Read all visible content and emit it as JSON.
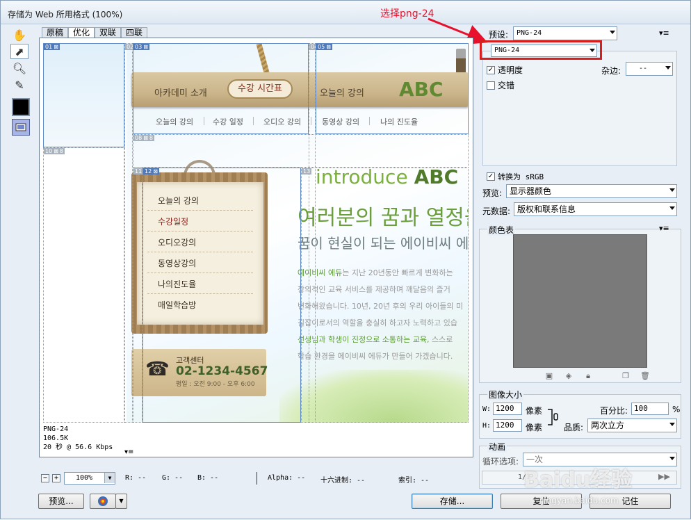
{
  "window": {
    "title": "存储为 Web 所用格式 (100%)"
  },
  "annotation": {
    "text": "选择png-24",
    "color": "#e8112d"
  },
  "tabs": [
    "原稿",
    "优化",
    "双联",
    "四联"
  ],
  "canvas": {
    "slices": [
      "01",
      "02",
      "03",
      "04",
      "05",
      "08",
      "10",
      "11",
      "12",
      "13"
    ],
    "nav": [
      "아카데미 소개",
      "수강 시간표",
      "오늘의 강의"
    ],
    "logo": "ABC",
    "subnav": [
      "오늘의 강의",
      "수강 일정",
      "오디오 강의",
      "동영상 강의",
      "나의 진도율"
    ],
    "menu": [
      "오늘의 강의",
      "수강일정",
      "오디오강의",
      "동영상강의",
      "나의진도율",
      "매일학습방"
    ],
    "phone": {
      "label": "고객센터",
      "number": "02-1234-4567",
      "hours": "평일 : 오전 9:00 - 오후 6:00"
    },
    "introduce": {
      "prefix": "introduce ",
      "brand": "ABC"
    },
    "heading1": "여러분의 꿈과 열정을",
    "heading2": "꿈이 현실이 되는 에이비씨 에",
    "body": [
      {
        "accent": "에이비씨 에듀",
        "text": "는 지난 20년동안 빠르게 변화하는"
      },
      {
        "accent": "",
        "text": "창의적인 교육 서비스를 제공하며 깨달음의 즐거"
      },
      {
        "accent": "",
        "text": "변화해왔습니다. 10년, 20년 후의 우리 아이들의 미"
      },
      {
        "accent": "",
        "text": "길잡이로서의 역할을 충실히 하고자 노력하고 있습"
      },
      {
        "accent": "선생님과 학생이 진정으로 소통하는 교육,",
        "text": " 스스로"
      },
      {
        "accent": "",
        "text": "학습 환경을 에이비씨 에듀가 만들어 가겠습니다."
      }
    ]
  },
  "info": {
    "format": "PNG-24",
    "size": "106.5K",
    "speed": "20 秒 @ 56.6 Kbps"
  },
  "status": {
    "zoom": "100%",
    "r": "R: --",
    "g": "G: --",
    "b": "B: --",
    "alpha": "Alpha: --",
    "hex": "十六进制: --",
    "index": "索引: --"
  },
  "buttons": {
    "preview": "预览...",
    "save": "存储...",
    "reset": "复位",
    "remember": "记住"
  },
  "right": {
    "preset_label": "预设:",
    "preset_value": "PNG-24",
    "format_value": "PNG-24",
    "transparency": "透明度",
    "interlace": "交错",
    "matte_label": "杂边:",
    "matte_value": "--",
    "convert_srgb": "转换为 sRGB",
    "preview_label": "预览:",
    "preview_value": "显示器颜色",
    "metadata_label": "元数据:",
    "metadata_value": "版权和联系信息",
    "color_table": "颜色表",
    "image_size": "图像大小",
    "w_label": "W:",
    "w_value": "1200",
    "h_label": "H:",
    "h_value": "1200",
    "px_unit": "像素",
    "percent_label": "百分比:",
    "percent_value": "100",
    "percent_unit": "%",
    "quality_label": "品质:",
    "quality_value": "两次立方",
    "animation": "动画",
    "loop_label": "循环选项:",
    "loop_value": "一次",
    "frame": "1/1"
  },
  "watermark": {
    "logo": "Baidu经验",
    "url": "jingyan.baidu.com"
  }
}
